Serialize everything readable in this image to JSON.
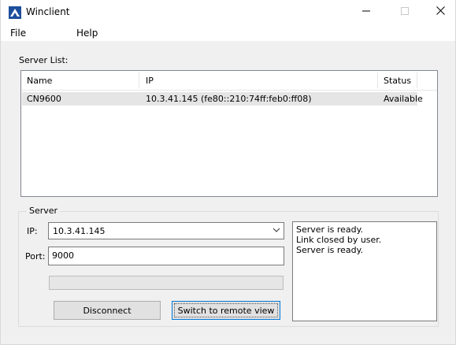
{
  "window": {
    "title": "Winclient",
    "controls": [
      "minimize-icon",
      "maximize-icon",
      "close-icon"
    ]
  },
  "menu": {
    "file": "File",
    "help": "Help"
  },
  "server_list": {
    "label": "Server List:",
    "columns": {
      "name": "Name",
      "ip": "IP",
      "status": "Status"
    },
    "rows": [
      {
        "name": "CN9600",
        "ip": "10.3.41.145 (fe80::210:74ff:feb0:ff08)",
        "status": "Available",
        "selected": true
      }
    ]
  },
  "server": {
    "group_label": "Server",
    "ip_label": "IP:",
    "ip_value": "10.3.41.145",
    "port_label": "Port:",
    "port_value": "9000",
    "progress": 0
  },
  "buttons": {
    "disconnect": "Disconnect",
    "switch": "Switch to remote view"
  },
  "log": {
    "lines": [
      "Server is ready.",
      "Link closed by user.",
      "Server is ready."
    ]
  },
  "colors": {
    "window_bg": "#f0f0f0",
    "selection_bg": "#e5e5e5",
    "focus_border": "#0078d7",
    "icon_blue": "#1c4f9c"
  }
}
